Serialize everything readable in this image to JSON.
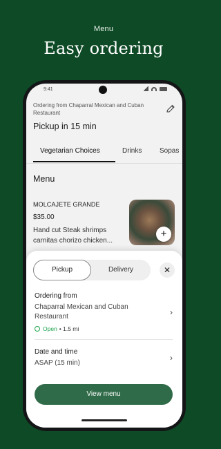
{
  "promo": {
    "eyebrow": "Menu",
    "title": "Easy ordering"
  },
  "statusbar": {
    "time": "9:41",
    "icons": [
      "signal-icon",
      "wifi-icon",
      "battery-icon"
    ]
  },
  "header": {
    "ordering_from": "Ordering from Chaparral Mexican and Cuban Restaurant",
    "pickup_time": "Pickup in 15 min",
    "edit_icon": "pencil-icon"
  },
  "tabs": [
    {
      "label": "Vegetarian Choices",
      "active": true
    },
    {
      "label": "Drinks",
      "active": false
    },
    {
      "label": "Sopas",
      "active": false
    }
  ],
  "menu": {
    "heading": "Menu",
    "item": {
      "name": "MOLCAJETE GRANDE",
      "price": "$35.00",
      "description": "Hand cut Steak shrimps carnitas chorizo chicken...",
      "add_icon": "plus-icon"
    }
  },
  "sheet": {
    "toggle": {
      "pickup": "Pickup",
      "delivery": "Delivery",
      "selected": "Pickup"
    },
    "close_icon": "close-icon",
    "ordering_from_label": "Ordering from",
    "restaurant_name": "Chaparral Mexican and Cuban Restaurant",
    "open_status": "Open",
    "distance": "• 1.5 mi",
    "date_time_label": "Date and time",
    "date_time_value": "ASAP (15 min)",
    "cta": "View menu"
  },
  "colors": {
    "background": "#0e4a26",
    "cta": "#2f6b48",
    "open_green": "#1aa34a"
  }
}
